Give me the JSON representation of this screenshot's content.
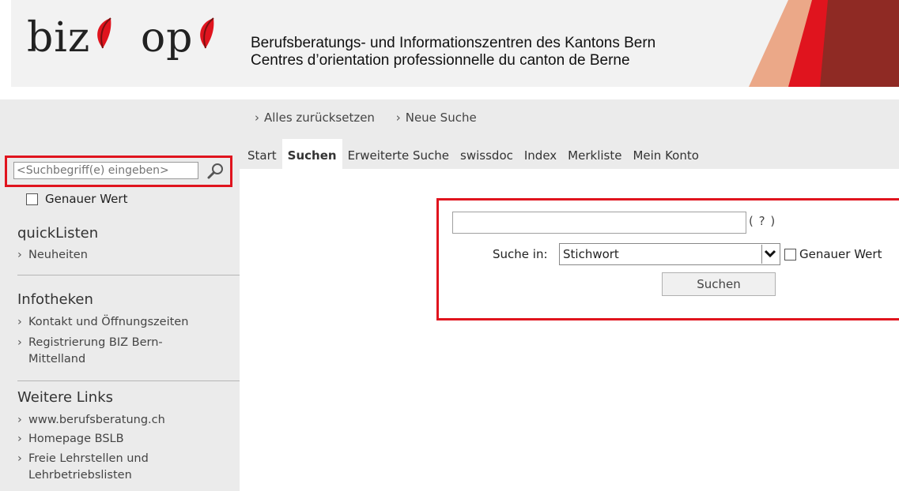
{
  "header": {
    "logo_text_1": "biz",
    "logo_text_2": "op",
    "subtitle_line1": "Berufsberatungs- und Informationszentren des Kantons Bern",
    "subtitle_line2": "Centres d’orientation professionnelle du canton de Berne",
    "brand_color": "#e0141e",
    "brand_dark": "#8f2a24",
    "brand_light": "#eba888"
  },
  "breadcrumb": {
    "items": [
      "Alles zurücksetzen",
      "Neue Suche"
    ]
  },
  "tabs": [
    {
      "label": "Start",
      "active": false
    },
    {
      "label": "Suchen",
      "active": true
    },
    {
      "label": "Erweiterte Suche",
      "active": false
    },
    {
      "label": "swissdoc",
      "active": false
    },
    {
      "label": "Index",
      "active": false
    },
    {
      "label": "Merkliste",
      "active": false
    },
    {
      "label": "Mein Konto",
      "active": false
    }
  ],
  "sidebar": {
    "search_placeholder": "<Suchbegriff(e) eingeben>",
    "exact_label": "Genauer Wert",
    "quick_title": "quickListen",
    "quick_items": [
      "Neuheiten"
    ],
    "info_title": "Infotheken",
    "info_items": [
      "Kontakt und Öffnungszeiten",
      "Registrierung BIZ Bern-",
      "Mittelland"
    ],
    "links_title": "Weitere Links",
    "links_items": [
      "www.berufsberatung.ch",
      "Homepage BSLB",
      "Freie Lehrstellen und",
      "Lehrbetriebslisten"
    ]
  },
  "search_form": {
    "query_value": "",
    "help": "( ? )",
    "search_in_label": "Suche in:",
    "search_in_value": "Stichwort",
    "exact_label": "Genauer Wert",
    "submit_label": "Suchen"
  },
  "highlight_color": "#e0141e"
}
